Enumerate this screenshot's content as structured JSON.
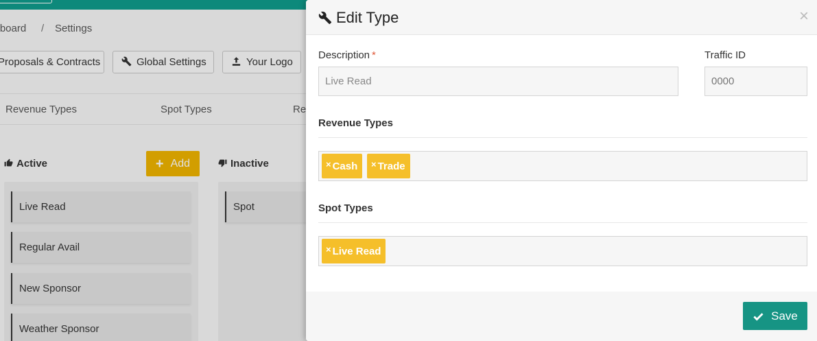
{
  "breadcrumb": [
    "shboard",
    "Settings"
  ],
  "breadcrumb_separator": "/",
  "toolbar": {
    "proposals_label": "Proposals & Contracts",
    "global_settings_label": "Global Settings",
    "your_logo_label": "Your Logo"
  },
  "tabs": [
    "Revenue Types",
    "Spot Types",
    "Re"
  ],
  "active_column": {
    "heading": "Active",
    "add_label": "Add",
    "items": [
      "Live Read",
      "Regular Avail",
      "New Sponsor",
      "Weather Sponsor"
    ]
  },
  "inactive_column": {
    "heading": "Inactive",
    "items": [
      "Spot"
    ]
  },
  "modal": {
    "title": "Edit Type",
    "close_symbol": "×",
    "description_label": "Description",
    "required_mark": "*",
    "description_value": "Live Read",
    "traffic_id_label": "Traffic ID",
    "traffic_id_placeholder": "0000",
    "revenue_types_label": "Revenue Types",
    "revenue_types": [
      "Cash",
      "Trade"
    ],
    "spot_types_label": "Spot Types",
    "spot_types": [
      "Live Read"
    ],
    "tag_remove_symbol": "×",
    "save_label": "Save"
  },
  "colors": {
    "topbar": "#0f9c8c",
    "add_button": "#f0b400",
    "tag": "#f5bf2a",
    "save_button": "#169484",
    "required": "#e05a3a"
  },
  "icons": [
    "wrench-icon",
    "upload-icon",
    "thumbs-up-icon",
    "thumbs-down-icon",
    "plus-icon",
    "check-icon",
    "close-icon"
  ]
}
